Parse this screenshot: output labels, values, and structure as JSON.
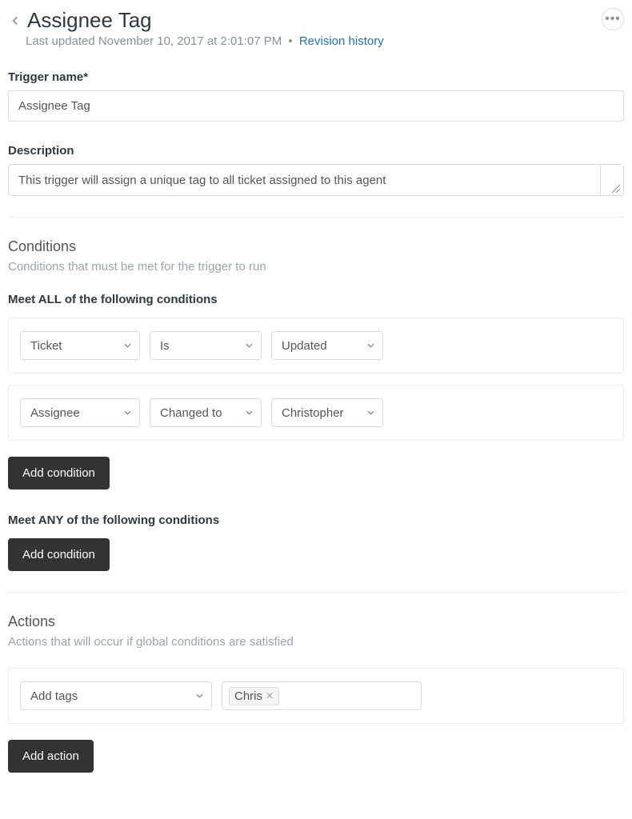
{
  "header": {
    "title": "Assignee Tag",
    "last_updated": "Last updated November 10, 2017 at 2:01:07 PM",
    "revision_link": "Revision history"
  },
  "fields": {
    "trigger_name_label": "Trigger name*",
    "trigger_name_value": "Assignee Tag",
    "description_label": "Description",
    "description_value": "This trigger will assign a unique tag to all ticket assigned to this agent"
  },
  "conditions_section": {
    "title": "Conditions",
    "subtitle": "Conditions that must be met for the trigger to run",
    "all_label": "Meet ALL of the following conditions",
    "any_label": "Meet ANY of the following conditions",
    "add_condition_label": "Add condition",
    "rows_all": [
      {
        "field": "Ticket",
        "operator": "Is",
        "value": "Updated"
      },
      {
        "field": "Assignee",
        "operator": "Changed to",
        "value": "Christopher"
      }
    ]
  },
  "actions_section": {
    "title": "Actions",
    "subtitle": "Actions that will occur if global conditions are satisfied",
    "add_action_label": "Add action",
    "row": {
      "field": "Add tags",
      "tag": "Chris"
    }
  }
}
